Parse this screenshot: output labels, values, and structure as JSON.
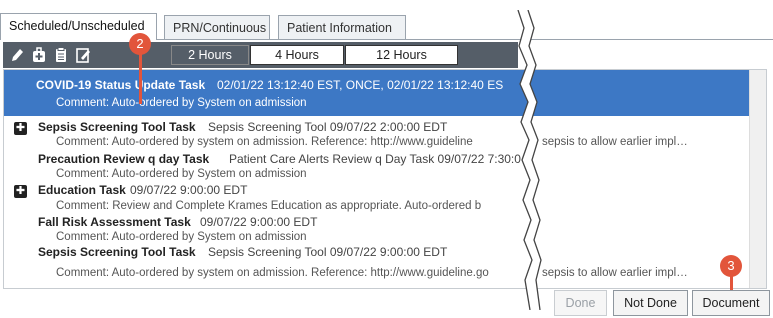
{
  "tabs": [
    {
      "label": "Scheduled/Unscheduled"
    },
    {
      "label": "PRN/Continuous"
    },
    {
      "label": "Patient Information"
    }
  ],
  "toolbar": {
    "icons": [
      "pencil-icon",
      "medical-bag-icon",
      "clipboard-icon",
      "edit-note-icon"
    ],
    "time_buttons": [
      "2 Hours",
      "4 Hours",
      "12 Hours"
    ],
    "selected": "2 Hours"
  },
  "tasks": [
    {
      "title": "COVID-19 Status Update Task",
      "detail": "02/01/22 13:12:40 EST, ONCE, 02/01/22 13:12:40 ES",
      "comment": "Comment: Auto-ordered by System on admission",
      "selected": true
    },
    {
      "title": "Sepsis Screening Tool Task",
      "detail": "Sepsis Screening Tool 09/07/22 2:00:00 EDT",
      "comment": "Comment: Auto-ordered by system on admission. Reference: http://www.guideline",
      "comment_tail": "sepsis to allow earlier impl…"
    },
    {
      "title": "Precaution Review q day Task",
      "detail": "Patient Care Alerts Review q Day Task 09/07/22 7:30:0",
      "comment": "Comment: Auto-ordered by System on admission"
    },
    {
      "title": "Education Task",
      "detail": "09/07/22 9:00:00 EDT",
      "comment": "Comment: Review and Complete Krames Education as appropriate. Auto-ordered b"
    },
    {
      "title": "Fall Risk Assessment Task",
      "detail": "09/07/22 9:00:00 EDT",
      "comment": "Comment: Auto-ordered by System on admission"
    },
    {
      "title": "Sepsis Screening Tool Task",
      "detail": "Sepsis Screening Tool 09/07/22 9:00:00 EDT",
      "comment": "Comment: Auto-ordered by system on admission. Reference: http://www.guideline.go",
      "comment_tail": "sepsis to allow earlier impl…"
    }
  ],
  "buttons": {
    "done": "Done",
    "not_done": "Not Done",
    "document": "Document"
  },
  "callouts": [
    "2",
    "3"
  ],
  "colors": {
    "selection": "#3d78c5",
    "toolbar": "#555e68",
    "callout": "#e2553b"
  }
}
